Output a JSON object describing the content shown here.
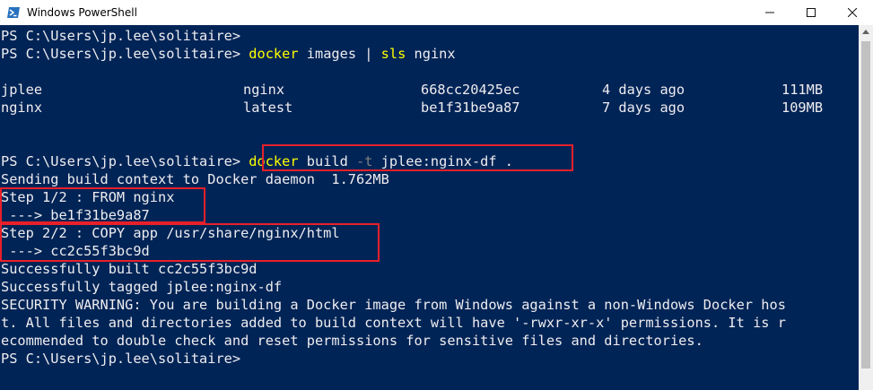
{
  "window": {
    "title": "Windows PowerShell"
  },
  "colors": {
    "background": "#012456",
    "text": "#eeedf0",
    "command": "#ffff00",
    "param": "#808080",
    "highlight_box": "#e8202a"
  },
  "icons": {
    "app": "powershell-icon",
    "minimize": "minimize-icon",
    "maximize": "maximize-icon",
    "close": "close-icon"
  },
  "terminal": {
    "prompt1": "PS C:\\Users\\jp.lee\\solitaire>",
    "prompt2": "PS C:\\Users\\jp.lee\\solitaire> ",
    "cmd1_docker": "docker",
    "cmd1_rest": " images | ",
    "cmd1_sls": "sls",
    "cmd1_arg": " nginx",
    "images": [
      {
        "repo": "jplee",
        "tag": "nginx",
        "id": "668cc20425ec",
        "created": "4 days ago",
        "size": "111MB"
      },
      {
        "repo": "nginx",
        "tag": "latest",
        "id": "be1f31be9a87",
        "created": "7 days ago",
        "size": "109MB"
      }
    ],
    "prompt3": "PS C:\\Users\\jp.lee\\solitaire> ",
    "cmd2_docker": "docker",
    "cmd2_build": " build ",
    "cmd2_flag": "-t",
    "cmd2_arg": " jplee:nginx-df .",
    "sending": "Sending build context to Docker daemon  1.762MB",
    "step1": "Step 1/2 : FROM nginx",
    "step1_result": " ---> be1f31be9a87",
    "step2": "Step 2/2 : COPY app /usr/share/nginx/html",
    "step2_result": " ---> cc2c55f3bc9d",
    "built": "Successfully built cc2c55f3bc9d",
    "tagged": "Successfully tagged jplee:nginx-df",
    "warning1": "SECURITY WARNING: You are building a Docker image from Windows against a non-Windows Docker hos",
    "warning2": "t. All files and directories added to build context will have '-rwxr-xr-x' permissions. It is r",
    "warning3": "ecommended to double check and reset permissions for sensitive files and directories.",
    "prompt4": "PS C:\\Users\\jp.lee\\solitaire>"
  }
}
